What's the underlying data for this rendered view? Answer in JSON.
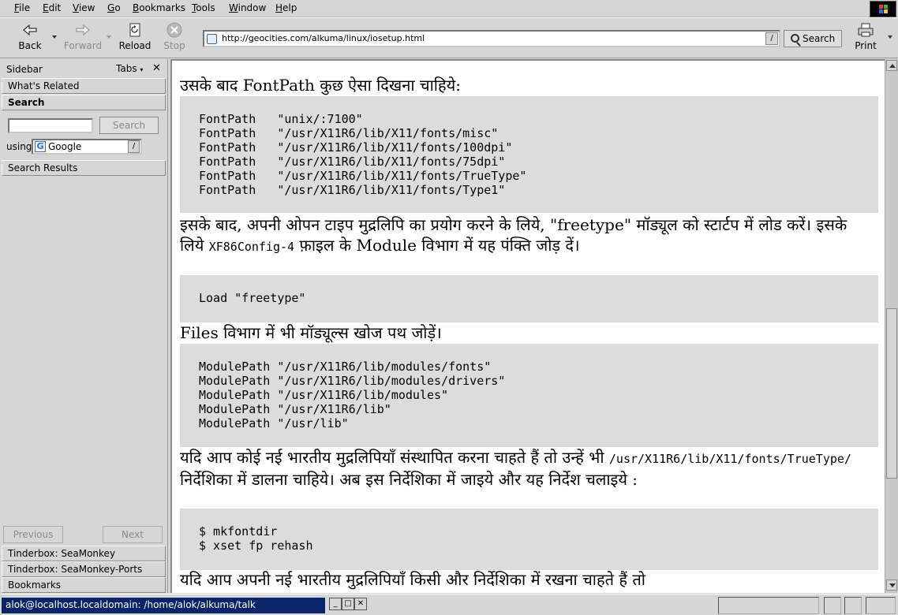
{
  "menubar": {
    "items": [
      {
        "label": "File",
        "underline": "F",
        "rest": "ile"
      },
      {
        "label": "Edit",
        "underline": "E",
        "rest": "dit"
      },
      {
        "label": "View",
        "underline": "V",
        "rest": "iew"
      },
      {
        "label": "Go",
        "underline": "G",
        "rest": "o"
      },
      {
        "label": "Bookmarks",
        "underline": "B",
        "rest": "ookmarks"
      },
      {
        "label": "Tools",
        "underline": "T",
        "rest": "ools"
      },
      {
        "label": "Window",
        "underline": "W",
        "rest": "indow"
      },
      {
        "label": "Help",
        "underline": "H",
        "rest": "elp"
      }
    ]
  },
  "toolbar": {
    "back": "Back",
    "forward": "Forward",
    "reload": "Reload",
    "stop": "Stop",
    "url": "http://geocities.com/alkuma/linux/iosetup.html",
    "search": "Search",
    "print": "Print"
  },
  "sidebar": {
    "title": "Sidebar",
    "tabs": "Tabs",
    "whats_related": "What's Related",
    "search_header": "Search",
    "search_input_value": "",
    "search_button": "Search",
    "using_label": "using",
    "engine": "Google",
    "results_header": "Search Results",
    "previous": "Previous",
    "next": "Next",
    "panels": [
      "Tinderbox: SeaMonkey",
      "Tinderbox: SeaMonkey-Ports",
      "Bookmarks"
    ]
  },
  "content": {
    "p1": "उसके बाद FontPath कुछ ऐसा दिखना चाहिये:",
    "code1": "FontPath   \"unix/:7100\"\nFontPath   \"/usr/X11R6/lib/X11/fonts/misc\"\nFontPath   \"/usr/X11R6/lib/X11/fonts/100dpi\"\nFontPath   \"/usr/X11R6/lib/X11/fonts/75dpi\"\nFontPath   \"/usr/X11R6/lib/X11/fonts/TrueType\"\nFontPath   \"/usr/X11R6/lib/X11/fonts/Type1\"",
    "p2_a": "इसके बाद, अपनी ओपन टाइप मुद्रलिपि का प्रयोग करने के लिये, \"freetype\" मॉड्यूल को स्टार्टप में लोड करें। इसके लिये ",
    "p2_code": "XF86Config-4",
    "p2_b": " फ़ाइल के Module विभाग में यह पंक्ति जोड़ दें।",
    "code2": "Load \"freetype\"",
    "p3": "Files विभाग में भी मॉड्यूल्स खोज पथ जोड़ें।",
    "code3": "ModulePath \"/usr/X11R6/lib/modules/fonts\"\nModulePath \"/usr/X11R6/lib/modules/drivers\"\nModulePath \"/usr/X11R6/lib/modules\"\nModulePath \"/usr/X11R6/lib\"\nModulePath \"/usr/lib\"",
    "p4_a": "यदि आप कोई नई भारतीय मुद्रलिपियाँ संस्थापित करना चाहते हैं तो उन्हें भी ",
    "p4_code": "/usr/X11R6/lib/X11/fonts/TrueType/",
    "p4_b": " निर्देशिका में डालना चाहिये। अब इस निर्देशिका में जाइये और यह निर्देश चलाइये :",
    "code4": "$ mkfontdir\n$ xset fp rehash",
    "p5": "यदि आप अपनी नई भारतीय मुद्रलिपियाँ किसी और निर्देशिका में रखना चाहते हैं तो"
  },
  "taskbar": {
    "task_title": "alok@localhost.localdomain: /home/alok/alkuma/talk"
  }
}
